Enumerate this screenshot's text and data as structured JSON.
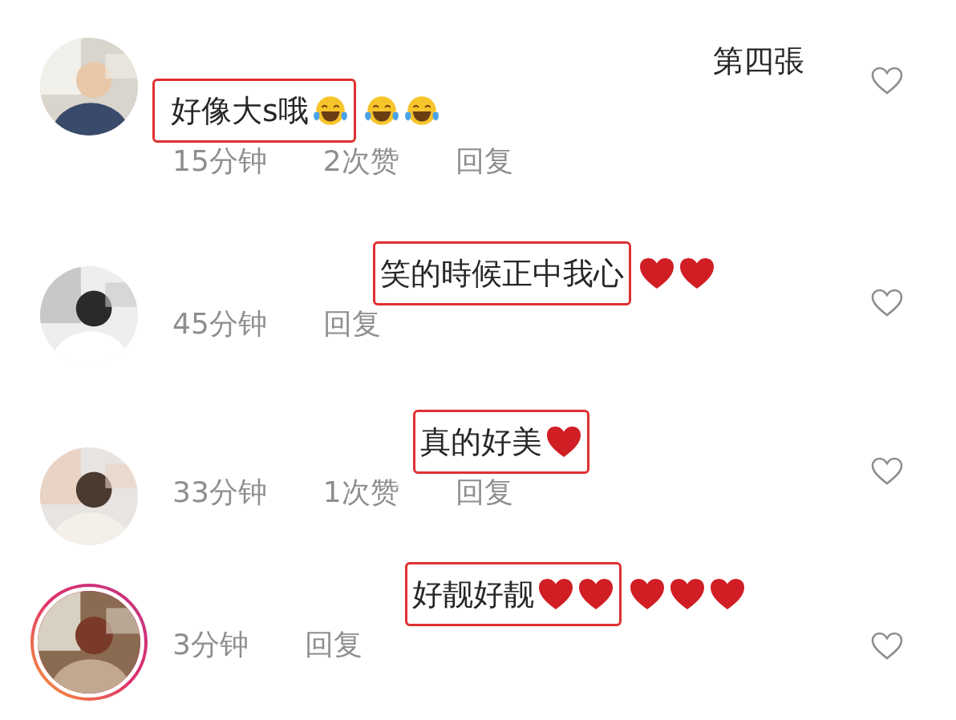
{
  "comments": [
    {
      "has_story": false,
      "lines": [
        {
          "segments": [
            {
              "highlighted": false,
              "items": [
                {
                  "kind": "text",
                  "text": "第四張"
                }
              ]
            }
          ]
        },
        {
          "segments": [
            {
              "highlighted": true,
              "items": [
                {
                  "kind": "text",
                  "text": "好像大s哦"
                },
                {
                  "kind": "laugh"
                }
              ]
            },
            {
              "highlighted": false,
              "items": [
                {
                  "kind": "laugh"
                },
                {
                  "kind": "laugh"
                }
              ]
            }
          ]
        }
      ],
      "time": "15分钟",
      "likes": "2次赞",
      "reply": "回复"
    },
    {
      "has_story": false,
      "lines": [
        {
          "segments": [
            {
              "highlighted": true,
              "items": [
                {
                  "kind": "text",
                  "text": "笑的時候正中我心"
                }
              ]
            },
            {
              "highlighted": false,
              "items": [
                {
                  "kind": "heart"
                },
                {
                  "kind": "heart"
                }
              ]
            }
          ]
        }
      ],
      "time": "45分钟",
      "reply": "回复"
    },
    {
      "has_story": false,
      "lines": [
        {
          "segments": [
            {
              "highlighted": true,
              "items": [
                {
                  "kind": "text",
                  "text": "真的好美"
                },
                {
                  "kind": "heart"
                }
              ]
            }
          ]
        }
      ],
      "time": "33分钟",
      "likes": "1次赞",
      "reply": "回复"
    },
    {
      "has_story": true,
      "lines": [
        {
          "segments": [
            {
              "highlighted": true,
              "items": [
                {
                  "kind": "text",
                  "text": "好靓好靓"
                },
                {
                  "kind": "heart"
                },
                {
                  "kind": "heart"
                }
              ]
            },
            {
              "highlighted": false,
              "items": [
                {
                  "kind": "heart"
                },
                {
                  "kind": "heart"
                },
                {
                  "kind": "heart"
                }
              ]
            }
          ]
        }
      ],
      "time": "3分钟",
      "reply": "回复"
    }
  ]
}
